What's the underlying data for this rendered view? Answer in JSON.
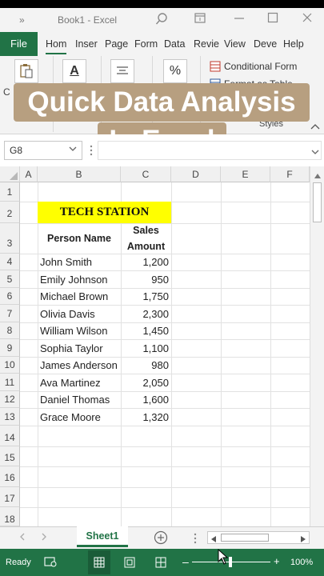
{
  "title_bar": {
    "label": "Book1  -  Excel",
    "chevron": "»"
  },
  "ribbon_tabs": [
    "File",
    "Hom",
    "Inser",
    "Page",
    "Form",
    "Data",
    "Revie",
    "View",
    "Deve",
    "Help"
  ],
  "ribbon": {
    "conditional_format": "Conditional Form",
    "format_table": "Format as Table",
    "group_styles": "Styles",
    "clipboard_letter": "C",
    "font_button": "A",
    "percent_button": "%"
  },
  "overlay": {
    "line1": "Quick Data Analysis",
    "line2": "In Excel"
  },
  "formula_bar": {
    "name_box": "G8"
  },
  "columns": [
    "A",
    "B",
    "C",
    "D",
    "E",
    "F"
  ],
  "rows": [
    "1",
    "2",
    "3",
    "4",
    "5",
    "6",
    "7",
    "8",
    "9",
    "10",
    "11",
    "12",
    "13",
    "14",
    "15",
    "16",
    "17",
    "18"
  ],
  "sheet": {
    "title": "TECH STATION",
    "header_name": "Person Name",
    "header_sales_1": "Sales",
    "header_sales_2": "Amount",
    "records": [
      {
        "name": "John Smith",
        "sales": "1,200"
      },
      {
        "name": "Emily Johnson",
        "sales": "950"
      },
      {
        "name": "Michael Brown",
        "sales": "1,750"
      },
      {
        "name": "Olivia Davis",
        "sales": "2,300"
      },
      {
        "name": "William Wilson",
        "sales": "1,450"
      },
      {
        "name": "Sophia Taylor",
        "sales": "1,100"
      },
      {
        "name": "James Anderson",
        "sales": "980"
      },
      {
        "name": "Ava Martinez",
        "sales": "2,050"
      },
      {
        "name": "Daniel Thomas",
        "sales": "1,600"
      },
      {
        "name": "Grace Moore",
        "sales": "1,320"
      }
    ]
  },
  "sheet_tab": "Sheet1",
  "status": {
    "ready": "Ready",
    "zoom": "100%"
  },
  "colors": {
    "excel_green": "#217346",
    "title_fill": "#ffff00",
    "overlay": "#b79f80"
  }
}
